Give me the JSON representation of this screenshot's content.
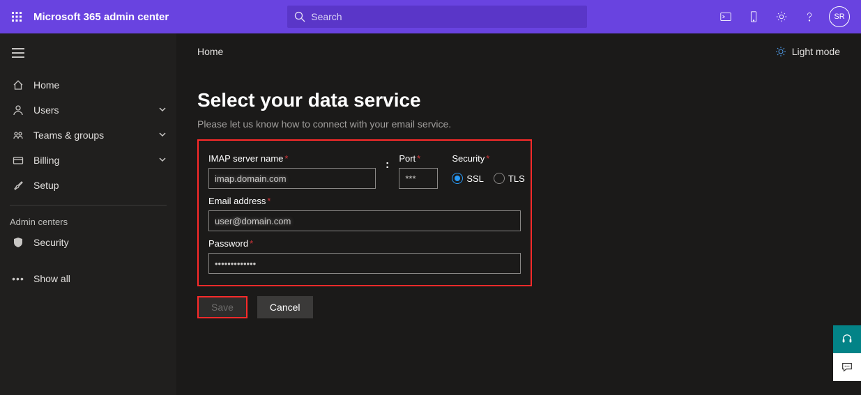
{
  "header": {
    "brand": "Microsoft 365 admin center",
    "search_placeholder": "Search",
    "avatar_initials": "SR"
  },
  "sidebar": {
    "items": [
      {
        "label": "Home",
        "expandable": false
      },
      {
        "label": "Users",
        "expandable": true
      },
      {
        "label": "Teams & groups",
        "expandable": true
      },
      {
        "label": "Billing",
        "expandable": true
      },
      {
        "label": "Setup",
        "expandable": false
      }
    ],
    "section_header": "Admin centers",
    "admin_items": [
      {
        "label": "Security"
      }
    ],
    "show_all": "Show all"
  },
  "main": {
    "breadcrumb": "Home",
    "light_mode": "Light mode",
    "title": "Select your data service",
    "subtitle": "Please let us know how to connect with your email service.",
    "form": {
      "imap_label": "IMAP server name",
      "imap_value": "imap.domain.com",
      "port_label": "Port",
      "port_value": "***",
      "security_label": "Security",
      "security_options": {
        "ssl": "SSL",
        "tls": "TLS"
      },
      "security_selected": "ssl",
      "email_label": "Email address",
      "email_value": "user@domain.com",
      "password_label": "Password",
      "password_value": "•••••••••••••"
    },
    "buttons": {
      "save": "Save",
      "cancel": "Cancel"
    }
  }
}
